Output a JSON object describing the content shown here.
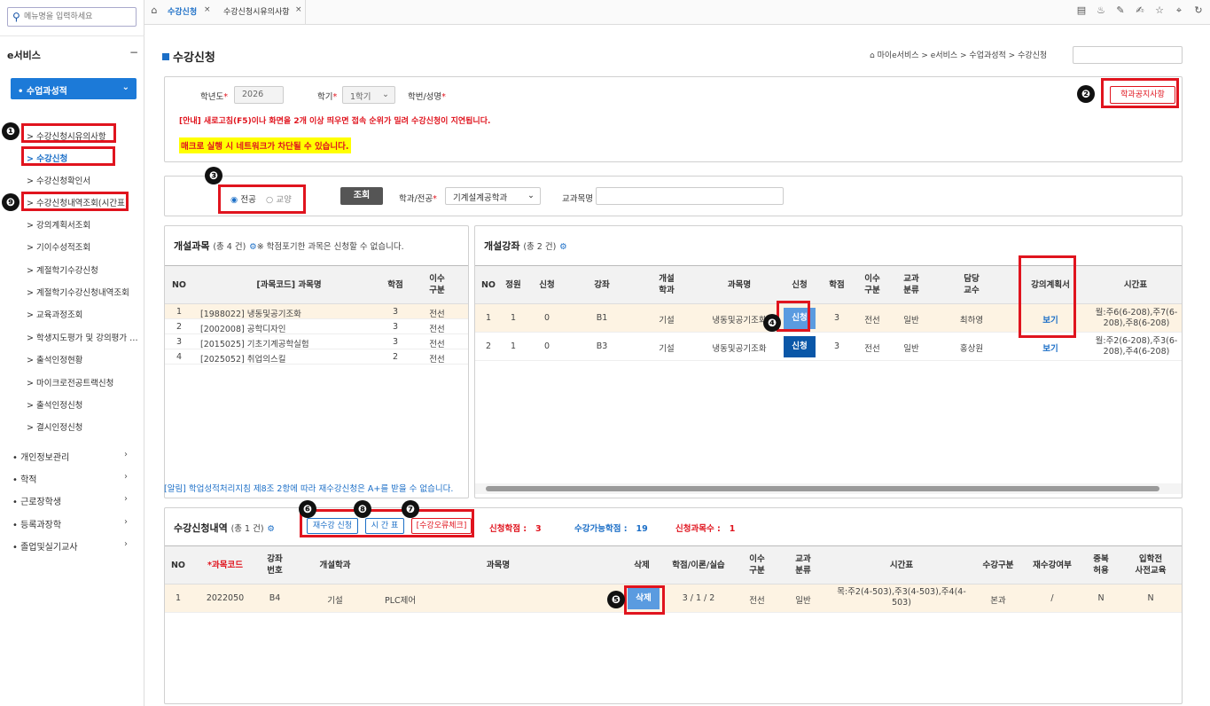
{
  "sidebar": {
    "search_placeholder": "메뉴명을 입력하세요",
    "service_title": "e서비스",
    "service_toggle": "−",
    "selected_group": "• 수업과성적",
    "sub_items": [
      {
        "label": "> 수강신청시유의사항"
      },
      {
        "label": "> 수강신청"
      },
      {
        "label": "> 수강신청확인서"
      },
      {
        "label": "> 수강신청내역조회(시간표)"
      },
      {
        "label": "> 강의계획서조회"
      },
      {
        "label": "> 기이수성적조회"
      },
      {
        "label": "> 계절학기수강신청"
      },
      {
        "label": "> 계절학기수강신청내역조회"
      },
      {
        "label": "> 교육과정조회"
      },
      {
        "label": "> 학생지도평가 및 강의평가 …"
      },
      {
        "label": "> 출석인정현황"
      },
      {
        "label": "> 마이크로전공트랙신청"
      },
      {
        "label": "> 출석인정신청"
      },
      {
        "label": "> 결시인정신청"
      }
    ],
    "top_items": [
      {
        "label": "• 개인정보관리"
      },
      {
        "label": "• 학적"
      },
      {
        "label": "• 근로장학생"
      },
      {
        "label": "• 등록과장학"
      },
      {
        "label": "• 졸업및실기교사"
      }
    ]
  },
  "tabs": [
    {
      "label": "수강신청"
    },
    {
      "label": "수강신청시유의사항"
    }
  ],
  "page": {
    "title": "수강신청",
    "breadcrumb": "마이e서비스 > e서비스 > 수업과성적 > 수강신청"
  },
  "filters": {
    "year_label": "학년도",
    "year_value": "2026",
    "term_label": "학기",
    "term_value": "1학기",
    "student_label": "학번/성명",
    "notice_button": "학과공지사항",
    "warning": "[안내] 새로고침(F5)이나 화면을 2개 이상 띄우면 접속 순위가 밀려 수강신청이 지연됩니다.",
    "macro_warning": "매크로 실행 시 네트워크가 차단될 수 있습니다."
  },
  "search": {
    "radio_major": "전공",
    "radio_liberal": "교양",
    "search_button": "조회",
    "dept_label": "학과/전공",
    "dept_value": "기계설계공학과",
    "course_name_label": "교과목명"
  },
  "open_courses": {
    "title": "개설과목",
    "count": "(총 4 건)",
    "note": "※ 학점포기한 과목은 신청할 수 없습니다.",
    "columns": [
      "NO",
      "[과목코드] 과목명",
      "학점",
      "이수\n구분"
    ],
    "rows": [
      {
        "no": "1",
        "name": "[1988022] 냉동및공기조화",
        "credit": "3",
        "type": "전선"
      },
      {
        "no": "2",
        "name": "[2002008] 공학디자인",
        "credit": "3",
        "type": "전선"
      },
      {
        "no": "3",
        "name": "[2015025] 기초기계공학실험",
        "credit": "3",
        "type": "전선"
      },
      {
        "no": "4",
        "name": "[2025052] 취업의스킬",
        "credit": "2",
        "type": "전선"
      }
    ]
  },
  "sections": {
    "title": "개설강좌",
    "count": "(총 2 건)",
    "columns": [
      "NO",
      "정원",
      "신청",
      "강좌",
      "개설\n학과",
      "과목명",
      "신청",
      "학점",
      "이수\n구분",
      "교과\n분류",
      "담당\n교수",
      "강의계획서",
      "시간표"
    ],
    "rows": [
      {
        "no": "1",
        "cap": "1",
        "applied": "0",
        "sec": "B1",
        "dept": "기설",
        "name": "냉동및공기조화",
        "apply": "신청",
        "credit": "3",
        "type": "전선",
        "cls": "일반",
        "prof": "최하영",
        "plan": "보기",
        "time": "월:주6(6-208),주7(6-208),주8(6-208)"
      },
      {
        "no": "2",
        "cap": "1",
        "applied": "0",
        "sec": "B3",
        "dept": "기설",
        "name": "냉동및공기조화",
        "apply": "신청",
        "credit": "3",
        "type": "전선",
        "cls": "일반",
        "prof": "홍상원",
        "plan": "보기",
        "time": "월:주2(6-208),주3(6-208),주4(6-208)"
      }
    ]
  },
  "alert": "[알림] 학업성적처리지침 제8조 2항에 따라 재수강신청은 A+를 받을 수 없습니다.",
  "registered": {
    "title": "수강신청내역",
    "count": "(총 1 건)",
    "btn_retake": "재수강 신청",
    "btn_timetable": "시 간 표",
    "btn_errcheck": "[수강오류체크]",
    "credit_label": "신청학점 :",
    "credit_value": "3",
    "avail_label": "수강가능학점 :",
    "avail_value": "19",
    "count_label": "신청과목수 :",
    "count_value": "1",
    "columns": [
      "NO",
      "*과목코드",
      "강좌\n번호",
      "개설학과",
      "과목명",
      "삭제",
      "학점/이론/실습",
      "이수\n구분",
      "교과\n분류",
      "시간표",
      "수강구분",
      "재수강여부",
      "중복\n허용",
      "입학전\n사전교육"
    ],
    "rows": [
      {
        "no": "1",
        "code": "2022050",
        "sec": "B4",
        "dept": "기설",
        "name": "PLC제어",
        "del": "삭제",
        "credit": "3 / 1 / 2",
        "type": "전선",
        "cls": "일반",
        "time": "목:주2(4-503),주3(4-503),주4(4-503)",
        "kind": "본과",
        "retake": "/",
        "dup": "N",
        "pre": "N"
      }
    ]
  },
  "badges": [
    "❶",
    "❷",
    "❸",
    "❹",
    "❺",
    "❻",
    "❽",
    "❼",
    "❾"
  ],
  "colors": {
    "accent": "#1c7ad8",
    "highlight": "#e0141e",
    "apply_button": "#0a57a8"
  }
}
